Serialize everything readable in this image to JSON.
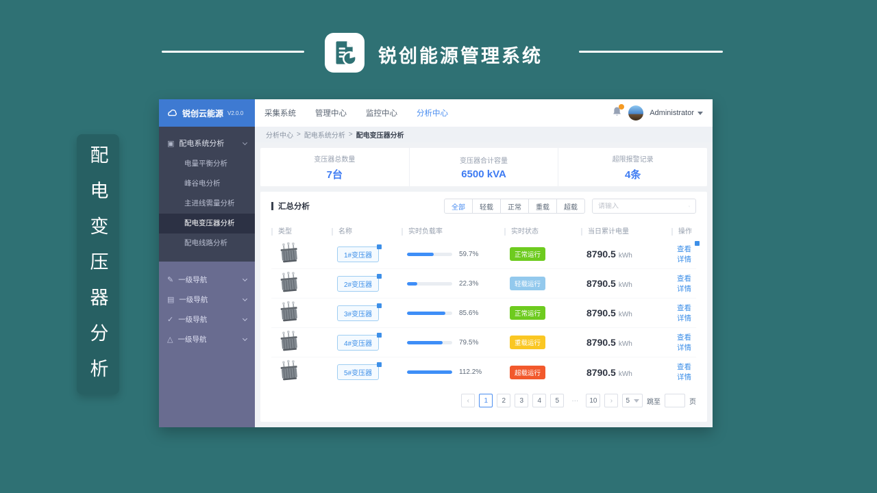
{
  "page": {
    "bg_color": "#2f7174",
    "banner_text": "配电变压器分析"
  },
  "header": {
    "title": "锐创能源管理系统",
    "icon": "document-chart-icon"
  },
  "app": {
    "logo": {
      "name": "锐创云能源",
      "version": "V2.0.0",
      "icon": "cloud-icon"
    },
    "sidebar": {
      "group_label": "配电系统分析",
      "items": [
        {
          "label": "电量平衡分析"
        },
        {
          "label": "峰谷电分析"
        },
        {
          "label": "主进线需量分析"
        },
        {
          "label": "配电变压器分析"
        },
        {
          "label": "配电线路分析"
        }
      ],
      "nav_groups": [
        {
          "icon": "edit-icon",
          "glyph": "✎",
          "label": "一级导航"
        },
        {
          "icon": "list-icon",
          "glyph": "▤",
          "label": "一级导航"
        },
        {
          "icon": "check-circle-icon",
          "glyph": "✓",
          "label": "一级导航"
        },
        {
          "icon": "warning-icon",
          "glyph": "△",
          "label": "一级导航"
        }
      ],
      "group_glyph": "▣"
    },
    "topbar": {
      "menus": [
        "采集系统",
        "管理中心",
        "监控中心",
        "分析中心"
      ],
      "user_name": "Administrator"
    },
    "breadcrumb": {
      "items": [
        "分析中心",
        "配电系统分析",
        "配电变压器分析"
      ],
      "separator": ">"
    },
    "stats": [
      {
        "label": "变压器总数量",
        "value": "7台"
      },
      {
        "label": "变压器合计容量",
        "value": "6500 kVA"
      },
      {
        "label": "超限报警记录",
        "value": "4条"
      }
    ],
    "panel": {
      "title": "汇总分析",
      "filters": [
        "全部",
        "轻载",
        "正常",
        "重载",
        "超载"
      ],
      "active_filter": "全部",
      "search_placeholder": "请输入",
      "table": {
        "headers": [
          "类型",
          "名称",
          "实时负载率",
          "实时状态",
          "当日累计电量",
          "操作"
        ],
        "energy_unit": "kWh",
        "action_label": "查看详情",
        "rows": [
          {
            "name": "1#变压器",
            "load_pct": 59.7,
            "load_label": "59.7%",
            "status": "正常运行",
            "status_color": "#6ecb1f",
            "energy": "8790.5",
            "action_flag": true
          },
          {
            "name": "2#变压器",
            "load_pct": 22.3,
            "load_label": "22.3%",
            "status": "轻载运行",
            "status_color": "#93c9ed",
            "energy": "8790.5",
            "action_flag": false
          },
          {
            "name": "3#变压器",
            "load_pct": 85.6,
            "load_label": "85.6%",
            "status": "正常运行",
            "status_color": "#6ecb1f",
            "energy": "8790.5",
            "action_flag": false
          },
          {
            "name": "4#变压器",
            "load_pct": 79.5,
            "load_label": "79.5%",
            "status": "重载运行",
            "status_color": "#fac723",
            "energy": "8790.5",
            "action_flag": false
          },
          {
            "name": "5#变压器",
            "load_pct": 112.2,
            "load_label": "112.2%",
            "status": "超载运行",
            "status_color": "#f2592c",
            "energy": "8790.5",
            "action_flag": false
          }
        ]
      },
      "pagination": {
        "prev": "‹",
        "next": "›",
        "pages": [
          "1",
          "2",
          "3",
          "4",
          "5",
          "···",
          "10"
        ],
        "active_page": "1",
        "page_size": "5",
        "jump_label": "跳至",
        "page_unit": "页"
      }
    },
    "accent_colors": {
      "primary_blue": "#3e7bf2",
      "link_blue": "#3d8fe8",
      "logo_blue": "#3e7ad2"
    }
  }
}
